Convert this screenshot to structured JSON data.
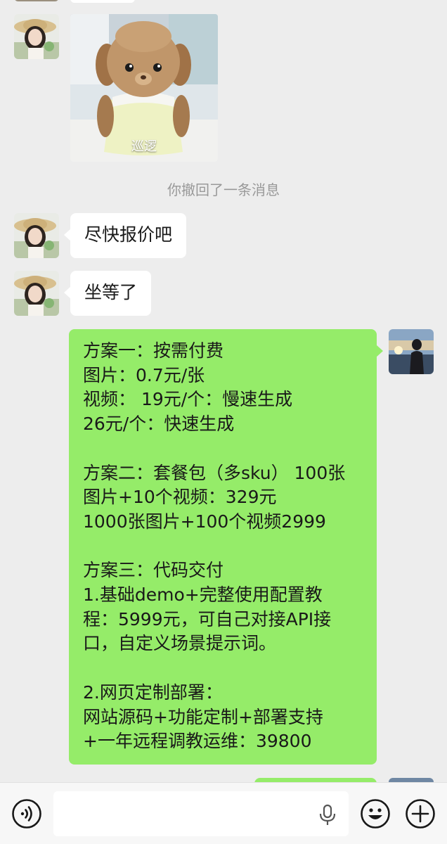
{
  "chat": {
    "sticker": {
      "caption": "巡逻"
    },
    "recall_notice": "你撤回了一条消息",
    "messages_left": [
      {
        "text": "尽快报价吧"
      },
      {
        "text": "坐等了"
      }
    ],
    "message_right": {
      "text": "方案一：按需付费\n图片：0.7元/张\n视频： 19元/个：慢速生成\n26元/个：快速生成\n\n方案二：套餐包（多sku） 100张\n图片+10个视频：329元\n1000张图片+100个视频2999\n\n方案三：代码交付\n1.基础demo+完整使用配置教\n程：5999元，可自己对接API接\n口，自定义场景提示词。\n\n2.网页定制部署：\n网站源码+功能定制+部署支持\n+一年远程调教运维：39800"
    }
  },
  "input_bar": {
    "icons": [
      "voice-icon",
      "microphone-icon",
      "emoji-icon",
      "plus-icon"
    ],
    "value": ""
  },
  "colors": {
    "background": "#ededed",
    "left_bubble": "#ffffff",
    "right_bubble": "#95ec69",
    "system_text": "#999999"
  }
}
